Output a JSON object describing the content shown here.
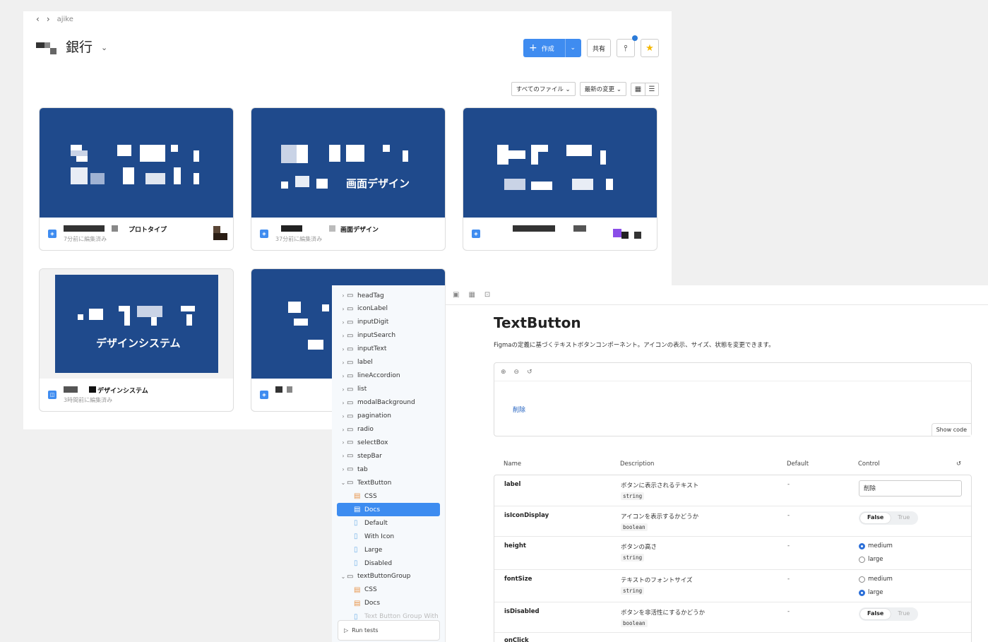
{
  "figma": {
    "breadcrumb": {
      "back": "‹",
      "forward": "›",
      "project": "ajike"
    },
    "project_title": "銀行",
    "toolbar": {
      "create_label": "作成",
      "share_label": "共有"
    },
    "filters": {
      "files": "すべてのファイル ⌄",
      "sort": "最新の変更 ⌄"
    },
    "cards": [
      {
        "name": "プロトタイプ",
        "edited": "7分前に編集済み"
      },
      {
        "name": "画面デザイン",
        "edited": "37分前に編集済み",
        "thumb_label": "画面デザイン"
      },
      {
        "name": "",
        "edited": ""
      },
      {
        "name": "デザインシステム",
        "edited": "3時間前に編集済み",
        "thumb_label": "デザインシステム"
      },
      {
        "name": "",
        "edited": ""
      }
    ]
  },
  "storybook": {
    "tree": [
      {
        "label": "headTag",
        "type": "folder"
      },
      {
        "label": "iconLabel",
        "type": "folder"
      },
      {
        "label": "inputDigit",
        "type": "folder"
      },
      {
        "label": "inputSearch",
        "type": "folder"
      },
      {
        "label": "inputText",
        "type": "folder"
      },
      {
        "label": "label",
        "type": "folder"
      },
      {
        "label": "lineAccordion",
        "type": "folder"
      },
      {
        "label": "list",
        "type": "folder"
      },
      {
        "label": "modalBackground",
        "type": "folder"
      },
      {
        "label": "pagination",
        "type": "folder"
      },
      {
        "label": "radio",
        "type": "folder"
      },
      {
        "label": "selectBox",
        "type": "folder"
      },
      {
        "label": "stepBar",
        "type": "folder"
      },
      {
        "label": "tab",
        "type": "folder"
      },
      {
        "label": "TextButton",
        "type": "folder-open"
      },
      {
        "label": "CSS",
        "type": "doc"
      },
      {
        "label": "Docs",
        "type": "doc-selected"
      },
      {
        "label": "Default",
        "type": "story"
      },
      {
        "label": "With Icon",
        "type": "story"
      },
      {
        "label": "Large",
        "type": "story"
      },
      {
        "label": "Disabled",
        "type": "story"
      },
      {
        "label": "textButtonGroup",
        "type": "folder-open"
      },
      {
        "label": "CSS",
        "type": "doc"
      },
      {
        "label": "Docs",
        "type": "doc"
      },
      {
        "label": "Text Button Group With",
        "type": "faded"
      }
    ],
    "run_tests": "Run tests",
    "doc": {
      "title": "TextButton",
      "description": "Figmaの定義に基づくテキストボタンコンポーネント。アイコンの表示、サイズ、状態を変更できます。",
      "preview_button": "削除",
      "show_code": "Show code"
    },
    "args_head": {
      "name": "Name",
      "description": "Description",
      "default": "Default",
      "control": "Control"
    },
    "args": [
      {
        "name": "label",
        "description": "ボタンに表示されるテキスト",
        "type": "string",
        "default": "-",
        "value": "削除"
      },
      {
        "name": "isIconDisplay",
        "description": "アイコンを表示するかどうか",
        "type": "boolean",
        "default": "-",
        "false_label": "False",
        "true_label": "True"
      },
      {
        "name": "height",
        "description": "ボタンの高さ",
        "type": "string",
        "default": "-",
        "opt1": "medium",
        "opt2": "large"
      },
      {
        "name": "fontSize",
        "description": "テキストのフォントサイズ",
        "type": "string",
        "default": "-",
        "opt1": "medium",
        "opt2": "large"
      },
      {
        "name": "isDisabled",
        "description": "ボタンを非活性にするかどうか",
        "type": "boolean",
        "default": "-",
        "false_label": "False",
        "true_label": "True"
      },
      {
        "name": "onClick",
        "description": "",
        "type": "",
        "default": ""
      }
    ]
  }
}
